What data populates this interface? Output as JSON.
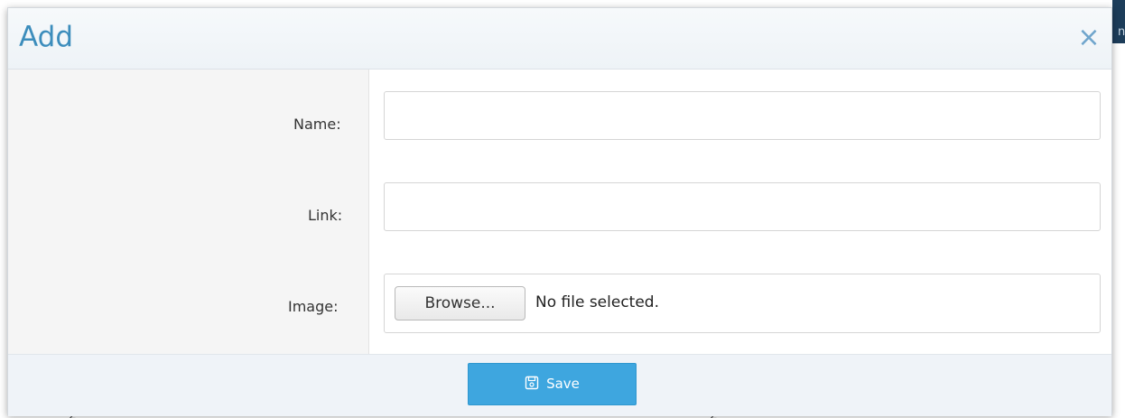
{
  "dialog": {
    "title": "Add",
    "close_glyph": "×"
  },
  "form": {
    "name_label": "Name:",
    "name_value": "",
    "link_label": "Link:",
    "link_value": "",
    "image_label": "Image:",
    "browse_label": "Browse...",
    "file_status": "No file selected."
  },
  "footer": {
    "save_label": "Save",
    "save_icon": "floppy-disk-icon"
  },
  "colors": {
    "title": "#3c8dbc",
    "close": "#6fa5cc",
    "save_button": "#3ea6df",
    "label_column": "#f5f5f5",
    "footer": "#eff3f8"
  }
}
